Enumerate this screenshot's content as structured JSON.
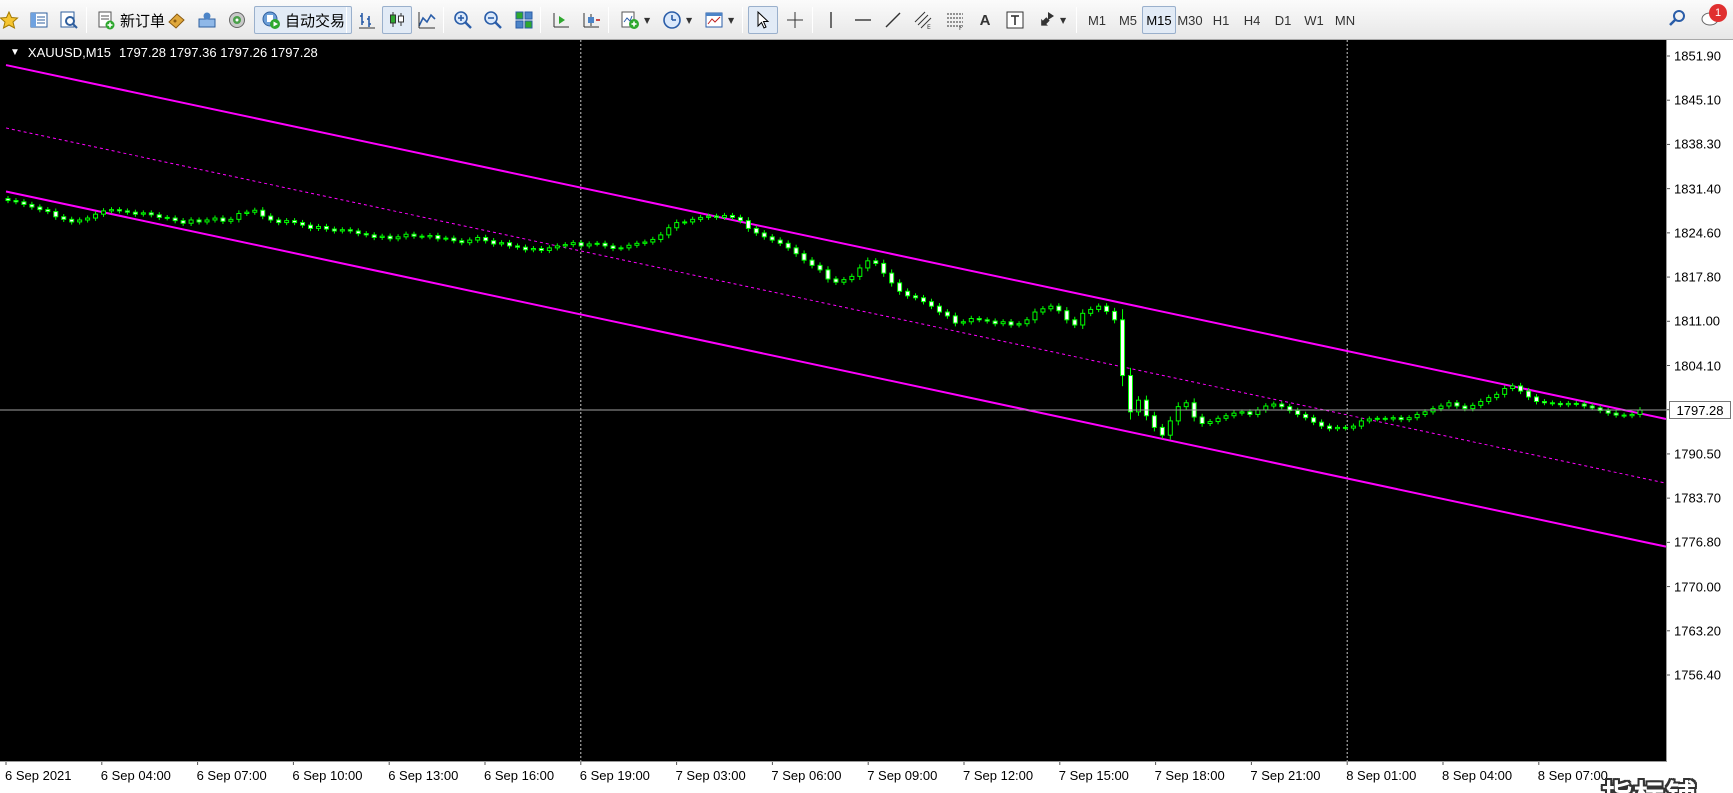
{
  "toolbar": {
    "new_order_label": "新订单",
    "auto_trade_label": "自动交易",
    "text_tool_label": "A",
    "timeframes": [
      "M1",
      "M5",
      "M15",
      "M30",
      "H1",
      "H4",
      "D1",
      "W1",
      "MN"
    ],
    "active_timeframe": "M15",
    "notification_count": "1"
  },
  "chart": {
    "symbol": "XAUUSD,M15",
    "ohlc": "1797.28 1797.36 1797.26 1797.28",
    "current_price": "1797.28",
    "watermark": "指标铺",
    "colors": {
      "background": "#000000",
      "bull_candle": "#00ff00",
      "bear_candle": "#ffffff",
      "channel": "#ff00ff",
      "bid_line": "#a0a0a0",
      "separators": "#c8c8c8"
    }
  },
  "chart_data": {
    "type": "candlestick",
    "y_ticks": [
      "1851.90",
      "1845.10",
      "1838.30",
      "1831.40",
      "1824.60",
      "1817.80",
      "1811.00",
      "1804.10",
      "1797.30",
      "1790.50",
      "1783.70",
      "1776.80",
      "1770.00",
      "1763.20",
      "1756.40"
    ],
    "y_range": [
      1756.4,
      1851.9
    ],
    "x_ticks": [
      "6 Sep 2021",
      "6 Sep 04:00",
      "6 Sep 07:00",
      "6 Sep 10:00",
      "6 Sep 13:00",
      "6 Sep 16:00",
      "6 Sep 19:00",
      "7 Sep 03:00",
      "7 Sep 06:00",
      "7 Sep 09:00",
      "7 Sep 12:00",
      "7 Sep 15:00",
      "7 Sep 18:00",
      "7 Sep 21:00",
      "8 Sep 01:00",
      "8 Sep 04:00",
      "8 Sep 07:00"
    ],
    "period_separators": [
      "6 Sep 19:00",
      "8 Sep 01:00"
    ],
    "channel": {
      "upper": [
        [
          0,
          1850.5
        ],
        [
          1,
          1795.9
        ]
      ],
      "middle": [
        [
          0,
          1840.8
        ],
        [
          1,
          1786.0
        ]
      ],
      "lower": [
        [
          0,
          1831.0
        ],
        [
          1,
          1776.2
        ]
      ]
    },
    "closes": [
      1829.6,
      1829.4,
      1829.0,
      1828.6,
      1828.2,
      1827.9,
      1827.1,
      1826.7,
      1826.3,
      1826.6,
      1826.9,
      1827.5,
      1828.0,
      1828.2,
      1828.0,
      1827.8,
      1827.5,
      1827.7,
      1827.4,
      1827.0,
      1826.9,
      1826.5,
      1826.1,
      1826.6,
      1826.3,
      1826.6,
      1826.9,
      1826.4,
      1826.7,
      1827.6,
      1827.8,
      1828.1,
      1827.2,
      1826.6,
      1826.2,
      1826.5,
      1826.2,
      1825.8,
      1825.3,
      1825.6,
      1825.2,
      1824.9,
      1825.1,
      1824.9,
      1824.5,
      1824.3,
      1823.9,
      1824.1,
      1823.7,
      1824.0,
      1824.4,
      1824.1,
      1824.0,
      1824.2,
      1823.7,
      1823.8,
      1823.4,
      1823.1,
      1823.5,
      1823.9,
      1823.4,
      1822.9,
      1823.1,
      1822.6,
      1822.4,
      1822.0,
      1822.2,
      1821.9,
      1822.3,
      1822.6,
      1822.8,
      1823.1,
      1822.6,
      1822.9,
      1823.0,
      1822.6,
      1822.2,
      1822.3,
      1822.7,
      1823.0,
      1823.2,
      1823.6,
      1824.3,
      1825.4,
      1826.2,
      1826.3,
      1826.7,
      1827.0,
      1827.2,
      1827.0,
      1827.3,
      1827.0,
      1826.5,
      1825.3,
      1824.6,
      1824.0,
      1823.5,
      1823.0,
      1822.3,
      1821.4,
      1820.4,
      1819.6,
      1818.9,
      1817.5,
      1817.0,
      1817.4,
      1817.9,
      1819.2,
      1820.3,
      1819.9,
      1818.4,
      1816.9,
      1815.6,
      1814.9,
      1814.6,
      1814.0,
      1813.3,
      1812.4,
      1811.8,
      1810.7,
      1810.9,
      1811.4,
      1811.2,
      1811.0,
      1810.6,
      1810.9,
      1810.4,
      1810.6,
      1811.2,
      1812.4,
      1812.9,
      1813.3,
      1812.6,
      1811.2,
      1810.4,
      1812.2,
      1812.8,
      1813.3,
      1812.5,
      1811.2,
      1802.6,
      1797.0,
      1798.8,
      1796.4,
      1794.6,
      1793.4,
      1795.6,
      1797.8,
      1798.4,
      1796.2,
      1795.2,
      1795.5,
      1796.0,
      1796.4,
      1796.8,
      1797.0,
      1796.6,
      1797.3,
      1797.9,
      1798.2,
      1797.8,
      1797.2,
      1796.6,
      1796.1,
      1795.4,
      1794.8,
      1794.4,
      1794.6,
      1794.5,
      1794.8,
      1795.6,
      1795.9,
      1796.0,
      1795.9,
      1796.1,
      1795.8,
      1796.1,
      1796.6,
      1797.0,
      1797.5,
      1797.9,
      1798.4,
      1797.9,
      1797.5,
      1798.0,
      1798.6,
      1799.2,
      1799.7,
      1800.6,
      1801.0,
      1800.2,
      1799.3,
      1798.6,
      1798.4,
      1798.3,
      1798.1,
      1798.3,
      1798.2,
      1797.9,
      1797.6,
      1797.2,
      1796.8,
      1796.5,
      1796.4,
      1796.6,
      1797.28
    ]
  }
}
